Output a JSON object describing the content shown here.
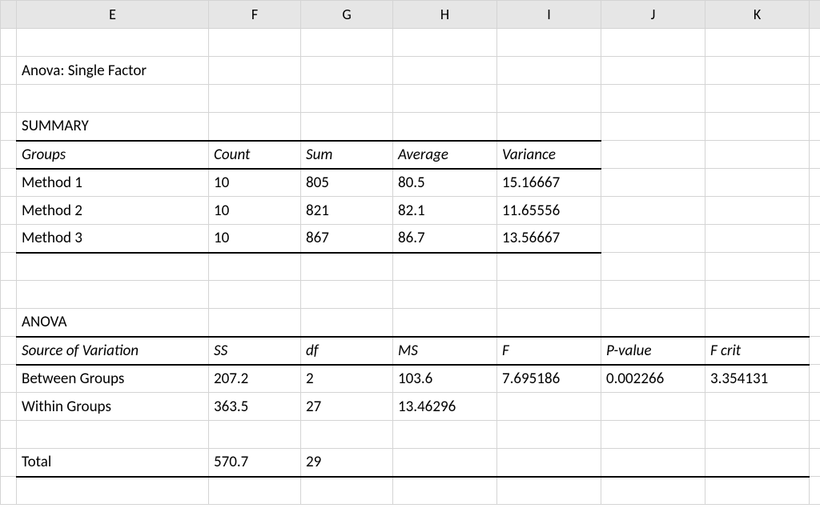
{
  "columns": {
    "E": "E",
    "F": "F",
    "G": "G",
    "H": "H",
    "I": "I",
    "J": "J",
    "K": "K"
  },
  "title": "Anova: Single Factor",
  "summary": {
    "heading": "SUMMARY",
    "cols": {
      "groups": "Groups",
      "count": "Count",
      "sum": "Sum",
      "average": "Average",
      "variance": "Variance"
    },
    "rows": [
      {
        "group": "Method 1",
        "count": "10",
        "sum": "805",
        "average": "80.5",
        "variance": "15.16667"
      },
      {
        "group": "Method 2",
        "count": "10",
        "sum": "821",
        "average": "82.1",
        "variance": "11.65556"
      },
      {
        "group": "Method 3",
        "count": "10",
        "sum": "867",
        "average": "86.7",
        "variance": "13.56667"
      }
    ]
  },
  "anova": {
    "heading": "ANOVA",
    "cols": {
      "sov": "Source of Variation",
      "ss": "SS",
      "df": "df",
      "ms": "MS",
      "f": "F",
      "pvalue": "P-value",
      "fcrit": "F crit"
    },
    "rows": [
      {
        "sov": "Between Groups",
        "ss": "207.2",
        "df": "2",
        "ms": "103.6",
        "f": "7.695186",
        "pvalue": "0.002266",
        "fcrit": "3.354131"
      },
      {
        "sov": "Within Groups",
        "ss": "363.5",
        "df": "27",
        "ms": "13.46296",
        "f": "",
        "pvalue": "",
        "fcrit": ""
      }
    ],
    "total": {
      "sov": "Total",
      "ss": "570.7",
      "df": "29"
    }
  }
}
